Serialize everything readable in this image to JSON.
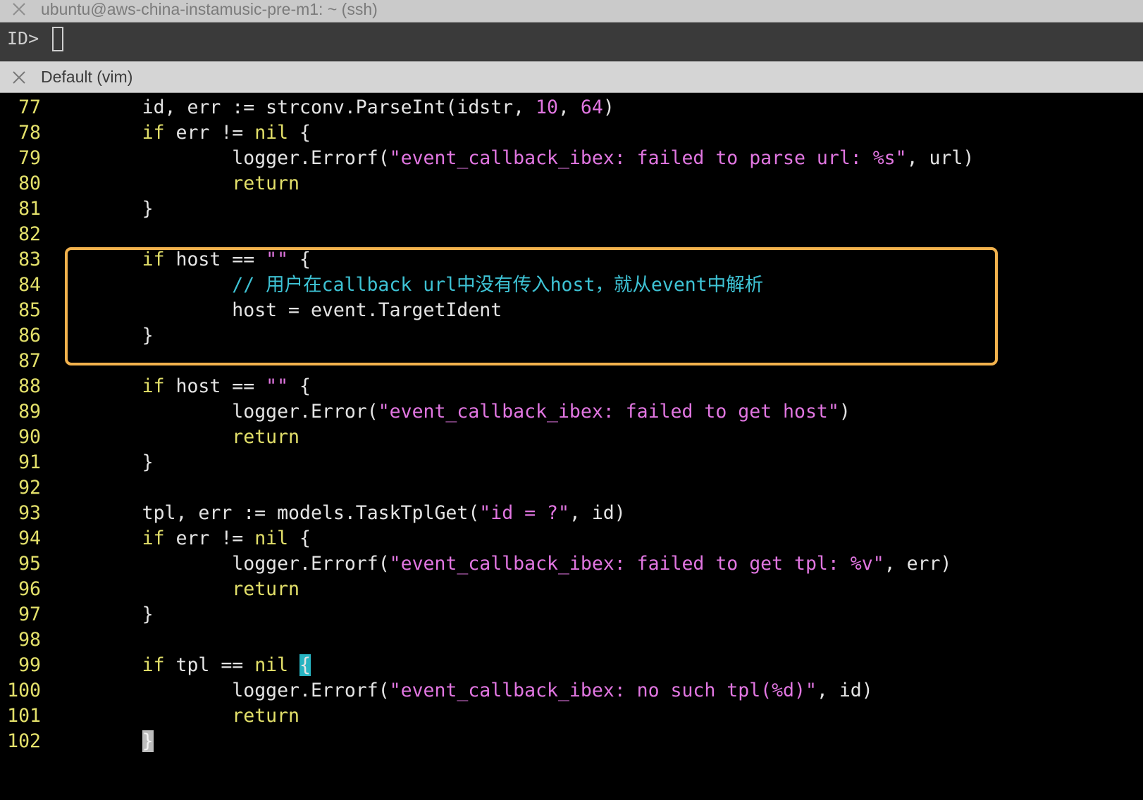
{
  "window": {
    "close_icon": "close-icon",
    "title": "ubuntu@aws-china-instamusic-pre-m1: ~ (ssh)"
  },
  "top_pane": {
    "prompt": "ID>"
  },
  "vim_tab": {
    "close_icon": "close-icon",
    "title": "Default (vim)"
  },
  "colors": {
    "plain": "#e4e4e4",
    "keyword": "#e3e06a",
    "string": "#e176e1",
    "number": "#e176e1",
    "comment": "#3ec3d5",
    "line_number": "#e3e06a",
    "match_bg": "#27b4c2",
    "cursor_bg": "#bdbdbd",
    "cursor_fg": "#f4f4f4",
    "highlight_box": "#f2b24d"
  },
  "vim": {
    "lines": [
      {
        "num": "77",
        "tokens": [
          {
            "type": "plain",
            "text": "\tid, err := strconv.ParseInt(idstr, "
          },
          {
            "type": "number",
            "text": "10"
          },
          {
            "type": "plain",
            "text": ", "
          },
          {
            "type": "number",
            "text": "64"
          },
          {
            "type": "plain",
            "text": ")"
          }
        ]
      },
      {
        "num": "78",
        "tokens": [
          {
            "type": "plain",
            "text": "\t"
          },
          {
            "type": "keyword",
            "text": "if"
          },
          {
            "type": "plain",
            "text": " err != "
          },
          {
            "type": "keyword",
            "text": "nil"
          },
          {
            "type": "plain",
            "text": " {"
          }
        ]
      },
      {
        "num": "79",
        "tokens": [
          {
            "type": "plain",
            "text": "\t\tlogger.Errorf("
          },
          {
            "type": "string",
            "text": "\"event_callback_ibex: failed to parse url: %s\""
          },
          {
            "type": "plain",
            "text": ", url)"
          }
        ]
      },
      {
        "num": "80",
        "tokens": [
          {
            "type": "plain",
            "text": "\t\t"
          },
          {
            "type": "keyword",
            "text": "return"
          }
        ]
      },
      {
        "num": "81",
        "tokens": [
          {
            "type": "plain",
            "text": "\t}"
          }
        ]
      },
      {
        "num": "82",
        "tokens": []
      },
      {
        "num": "83",
        "tokens": [
          {
            "type": "plain",
            "text": "\t"
          },
          {
            "type": "keyword",
            "text": "if"
          },
          {
            "type": "plain",
            "text": " host == "
          },
          {
            "type": "string",
            "text": "\"\""
          },
          {
            "type": "plain",
            "text": " {"
          }
        ]
      },
      {
        "num": "84",
        "tokens": [
          {
            "type": "plain",
            "text": "\t\t"
          },
          {
            "type": "comment",
            "text": "// 用户在callback url中没有传入host，就从event中解析"
          }
        ]
      },
      {
        "num": "85",
        "tokens": [
          {
            "type": "plain",
            "text": "\t\thost = event.TargetIdent"
          }
        ]
      },
      {
        "num": "86",
        "tokens": [
          {
            "type": "plain",
            "text": "\t}"
          }
        ]
      },
      {
        "num": "87",
        "tokens": []
      },
      {
        "num": "88",
        "tokens": [
          {
            "type": "plain",
            "text": "\t"
          },
          {
            "type": "keyword",
            "text": "if"
          },
          {
            "type": "plain",
            "text": " host == "
          },
          {
            "type": "string",
            "text": "\"\""
          },
          {
            "type": "plain",
            "text": " {"
          }
        ]
      },
      {
        "num": "89",
        "tokens": [
          {
            "type": "plain",
            "text": "\t\tlogger.Error("
          },
          {
            "type": "string",
            "text": "\"event_callback_ibex: failed to get host\""
          },
          {
            "type": "plain",
            "text": ")"
          }
        ]
      },
      {
        "num": "90",
        "tokens": [
          {
            "type": "plain",
            "text": "\t\t"
          },
          {
            "type": "keyword",
            "text": "return"
          }
        ]
      },
      {
        "num": "91",
        "tokens": [
          {
            "type": "plain",
            "text": "\t}"
          }
        ]
      },
      {
        "num": "92",
        "tokens": []
      },
      {
        "num": "93",
        "tokens": [
          {
            "type": "plain",
            "text": "\ttpl, err := models.TaskTplGet("
          },
          {
            "type": "string",
            "text": "\"id = ?\""
          },
          {
            "type": "plain",
            "text": ", id)"
          }
        ]
      },
      {
        "num": "94",
        "tokens": [
          {
            "type": "plain",
            "text": "\t"
          },
          {
            "type": "keyword",
            "text": "if"
          },
          {
            "type": "plain",
            "text": " err != "
          },
          {
            "type": "keyword",
            "text": "nil"
          },
          {
            "type": "plain",
            "text": " {"
          }
        ]
      },
      {
        "num": "95",
        "tokens": [
          {
            "type": "plain",
            "text": "\t\tlogger.Errorf("
          },
          {
            "type": "string",
            "text": "\"event_callback_ibex: failed to get tpl: %v\""
          },
          {
            "type": "plain",
            "text": ", err)"
          }
        ]
      },
      {
        "num": "96",
        "tokens": [
          {
            "type": "plain",
            "text": "\t\t"
          },
          {
            "type": "keyword",
            "text": "return"
          }
        ]
      },
      {
        "num": "97",
        "tokens": [
          {
            "type": "plain",
            "text": "\t}"
          }
        ]
      },
      {
        "num": "98",
        "tokens": []
      },
      {
        "num": "99",
        "tokens": [
          {
            "type": "plain",
            "text": "\t"
          },
          {
            "type": "keyword",
            "text": "if"
          },
          {
            "type": "plain",
            "text": " tpl == "
          },
          {
            "type": "keyword",
            "text": "nil"
          },
          {
            "type": "plain",
            "text": " "
          },
          {
            "type": "match",
            "text": "{"
          }
        ]
      },
      {
        "num": "100",
        "tokens": [
          {
            "type": "plain",
            "text": "\t\tlogger.Errorf("
          },
          {
            "type": "string",
            "text": "\"event_callback_ibex: no such tpl(%d)\""
          },
          {
            "type": "plain",
            "text": ", id)"
          }
        ]
      },
      {
        "num": "101",
        "tokens": [
          {
            "type": "plain",
            "text": "\t\t"
          },
          {
            "type": "keyword",
            "text": "return"
          }
        ]
      },
      {
        "num": "102",
        "tokens": [
          {
            "type": "plain",
            "text": "\t"
          },
          {
            "type": "cursor",
            "text": "}"
          }
        ]
      }
    ]
  }
}
